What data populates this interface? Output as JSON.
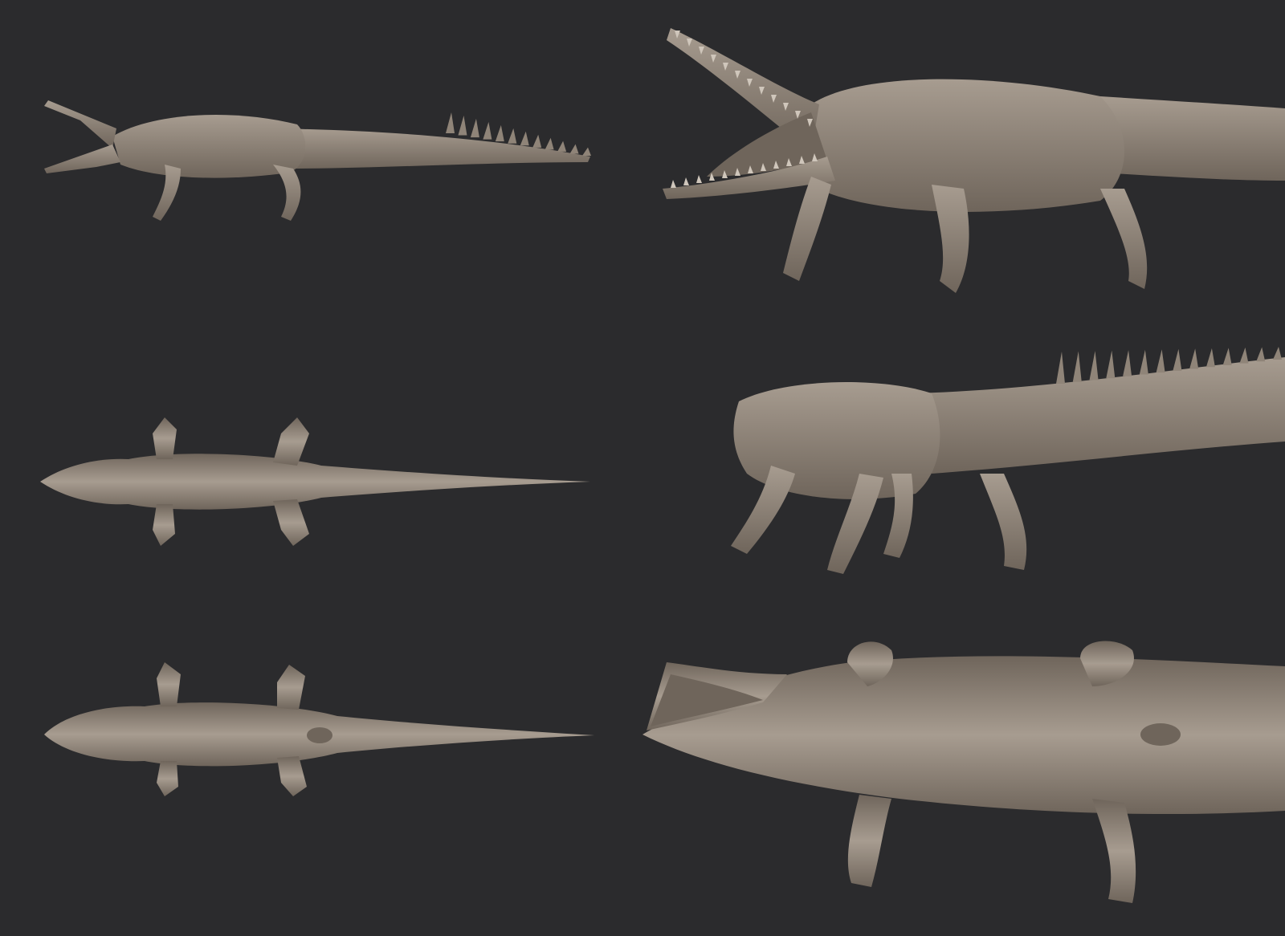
{
  "scene": {
    "background_color": "#2b2b2d",
    "model_color": "#8f8478",
    "model_shade_color": "#6f655b",
    "model_highlight_color": "#a79c90",
    "tooth_color": "#cfc6bb"
  },
  "views": [
    {
      "id": "side-small",
      "subject": "crocodile-side-view-open-jaw"
    },
    {
      "id": "top-small",
      "subject": "crocodile-top-view"
    },
    {
      "id": "bottom-small",
      "subject": "crocodile-bottom-view"
    },
    {
      "id": "front-large",
      "subject": "crocodile-three-quarter-front-open-jaw"
    },
    {
      "id": "rear-large",
      "subject": "crocodile-three-quarter-rear"
    },
    {
      "id": "under-large",
      "subject": "crocodile-underside-perspective"
    }
  ]
}
